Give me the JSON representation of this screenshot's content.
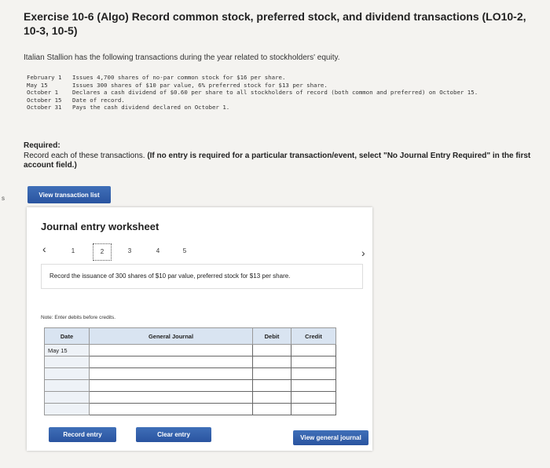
{
  "title": "Exercise 10-6 (Algo) Record common stock, preferred stock, and dividend transactions (LO10-2, 10-3, 10-5)",
  "intro": "Italian Stallion has the following transactions during the year related to stockholders' equity.",
  "transactions": [
    {
      "date": "February 1",
      "desc": "Issues 4,700 shares of no-par common stock for $16 per share."
    },
    {
      "date": "May 15",
      "desc": "Issues 300 shares of $10 par value, 6% preferred stock for $13 per share."
    },
    {
      "date": "October 1",
      "desc": "Declares a cash dividend of $0.60 per share to all stockholders of record (both common and preferred) on October 15."
    },
    {
      "date": "October 15",
      "desc": "Date of record."
    },
    {
      "date": "October 31",
      "desc": "Pays the cash dividend declared on October 1."
    }
  ],
  "required": {
    "heading": "Required:",
    "text": "Record each of these transactions.",
    "bold_note": "(If no entry is required for a particular transaction/event, select \"No Journal Entry Required\" in the first account field.)"
  },
  "buttons": {
    "view_transaction_list": "View transaction list",
    "record_entry": "Record entry",
    "clear_entry": "Clear entry",
    "view_general_journal": "View general journal"
  },
  "worksheet": {
    "title": "Journal entry worksheet",
    "pages": [
      "1",
      "2",
      "3",
      "4",
      "5"
    ],
    "active_page": "2",
    "instruction": "Record the issuance of 300 shares of $10 par value, preferred stock for $13 per share.",
    "note": "Note: Enter debits before credits.",
    "table": {
      "headers": [
        "Date",
        "General Journal",
        "Debit",
        "Credit"
      ],
      "date_value": "May 15"
    }
  },
  "side_mark": "s"
}
